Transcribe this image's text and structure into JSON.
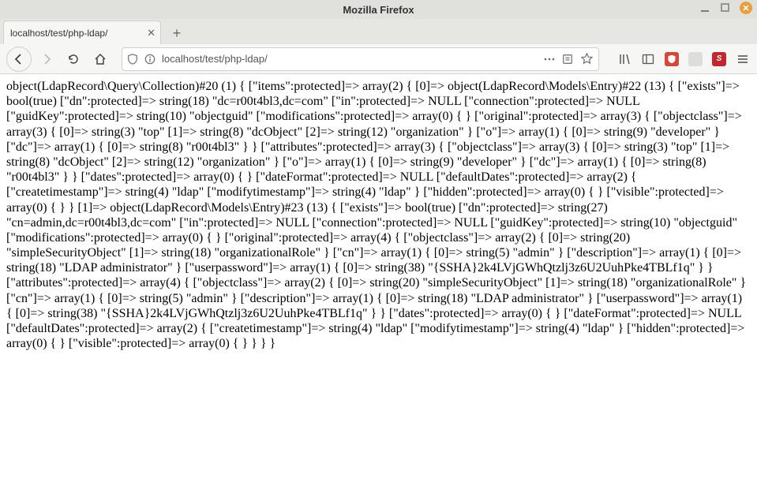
{
  "window": {
    "title": "Mozilla Firefox"
  },
  "tab": {
    "title": "localhost/test/php-ldap/"
  },
  "urlbar": {
    "url": "localhost/test/php-ldap/"
  },
  "content": {
    "dump": "object(LdapRecord\\Query\\Collection)#20 (1) { [\"items\":protected]=> array(2) { [0]=> object(LdapRecord\\Models\\Entry)#22 (13) { [\"exists\"]=> bool(true) [\"dn\":protected]=> string(18) \"dc=r00t4bl3,dc=com\" [\"in\":protected]=> NULL [\"connection\":protected]=> NULL [\"guidKey\":protected]=> string(10) \"objectguid\" [\"modifications\":protected]=> array(0) { } [\"original\":protected]=> array(3) { [\"objectclass\"]=> array(3) { [0]=> string(3) \"top\" [1]=> string(8) \"dcObject\" [2]=> string(12) \"organization\" } [\"o\"]=> array(1) { [0]=> string(9) \"developer\" } [\"dc\"]=> array(1) { [0]=> string(8) \"r00t4bl3\" } } [\"attributes\":protected]=> array(3) { [\"objectclass\"]=> array(3) { [0]=> string(3) \"top\" [1]=> string(8) \"dcObject\" [2]=> string(12) \"organization\" } [\"o\"]=> array(1) { [0]=> string(9) \"developer\" } [\"dc\"]=> array(1) { [0]=> string(8) \"r00t4bl3\" } } [\"dates\":protected]=> array(0) { } [\"dateFormat\":protected]=> NULL [\"defaultDates\":protected]=> array(2) { [\"createtimestamp\"]=> string(4) \"ldap\" [\"modifytimestamp\"]=> string(4) \"ldap\" } [\"hidden\":protected]=> array(0) { } [\"visible\":protected]=> array(0) { } } [1]=> object(LdapRecord\\Models\\Entry)#23 (13) { [\"exists\"]=> bool(true) [\"dn\":protected]=> string(27) \"cn=admin,dc=r00t4bl3,dc=com\" [\"in\":protected]=> NULL [\"connection\":protected]=> NULL [\"guidKey\":protected]=> string(10) \"objectguid\" [\"modifications\":protected]=> array(0) { } [\"original\":protected]=> array(4) { [\"objectclass\"]=> array(2) { [0]=> string(20) \"simpleSecurityObject\" [1]=> string(18) \"organizationalRole\" } [\"cn\"]=> array(1) { [0]=> string(5) \"admin\" } [\"description\"]=> array(1) { [0]=> string(18) \"LDAP administrator\" } [\"userpassword\"]=> array(1) { [0]=> string(38) \"{SSHA}2k4LVjGWhQtzlj3z6U2UuhPke4TBLf1q\" } } [\"attributes\":protected]=> array(4) { [\"objectclass\"]=> array(2) { [0]=> string(20) \"simpleSecurityObject\" [1]=> string(18) \"organizationalRole\" } [\"cn\"]=> array(1) { [0]=> string(5) \"admin\" } [\"description\"]=> array(1) { [0]=> string(18) \"LDAP administrator\" } [\"userpassword\"]=> array(1) { [0]=> string(38) \"{SSHA}2k4LVjGWhQtzlj3z6U2UuhPke4TBLf1q\" } } [\"dates\":protected]=> array(0) { } [\"dateFormat\":protected]=> NULL [\"defaultDates\":protected]=> array(2) { [\"createtimestamp\"]=> string(4) \"ldap\" [\"modifytimestamp\"]=> string(4) \"ldap\" } [\"hidden\":protected]=> array(0) { } [\"visible\":protected]=> array(0) { } } } }"
  }
}
